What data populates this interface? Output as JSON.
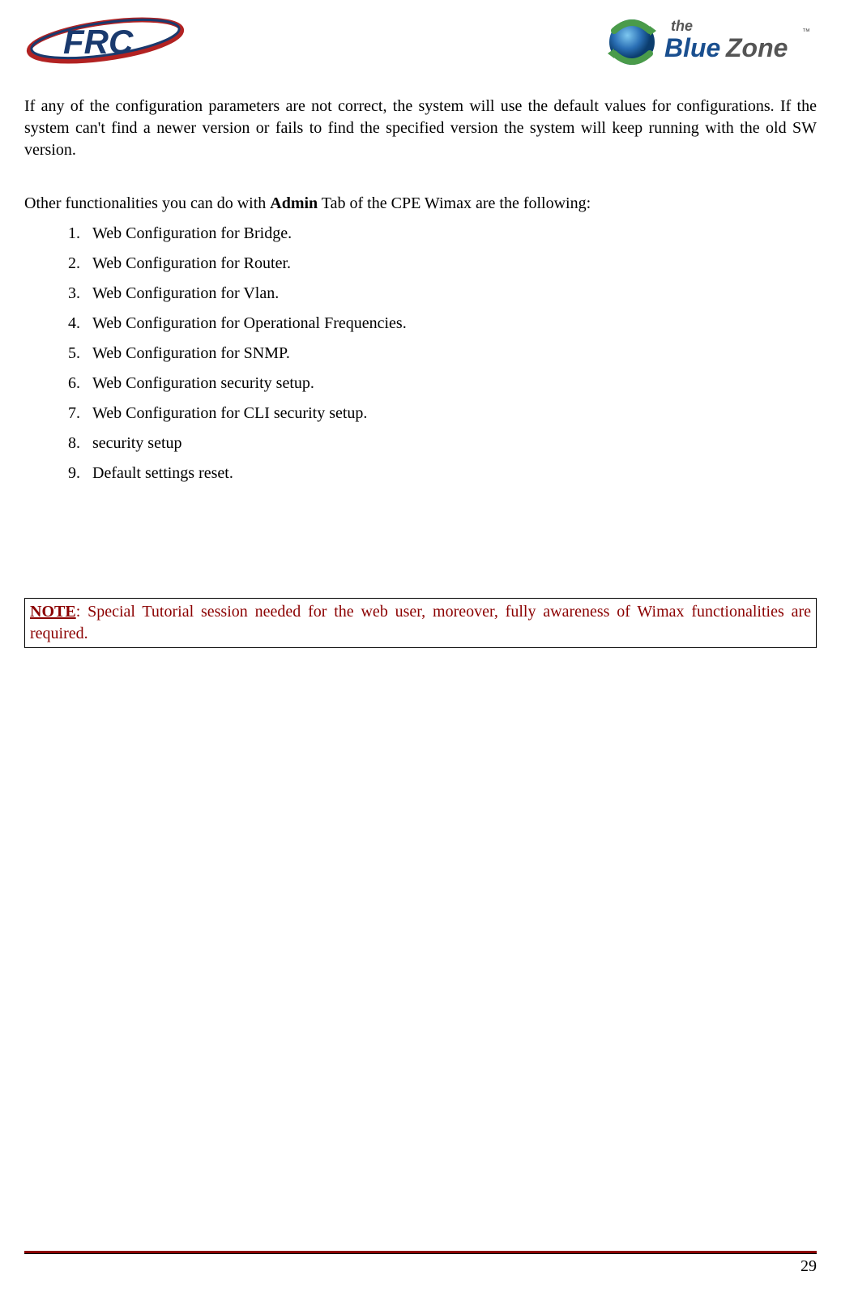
{
  "logos": {
    "left_alt": "FRC",
    "right_alt": "the BlueZone"
  },
  "paragraph1": "If any of the configuration parameters are not correct, the system will use the default values for configurations. If the system can't find a newer version or fails to find the specified version the system will keep running with the old SW version.",
  "intro": {
    "prefix": "Other functionalities you can do with ",
    "bold": "Admin",
    "suffix": " Tab of the CPE Wimax are the following:"
  },
  "list": [
    "Web Configuration for Bridge.",
    "Web Configuration for Router.",
    "Web Configuration for Vlan.",
    "Web Configuration for Operational Frequencies.",
    "Web Configuration for SNMP.",
    "Web Configuration security setup.",
    "Web Configuration for CLI security setup.",
    "security setup",
    "Default settings reset."
  ],
  "note": {
    "label": "NOTE",
    "text": ": Special Tutorial session needed for the web user, moreover, fully awareness of Wimax functionalities are required."
  },
  "page_number": "29"
}
